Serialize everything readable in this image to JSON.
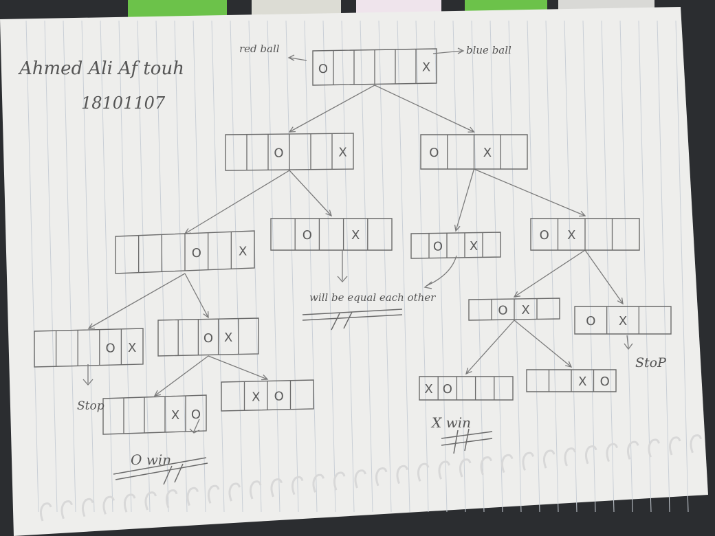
{
  "header": {
    "author": "Ahmed Ali Af touh",
    "id": "18101107"
  },
  "labels": {
    "red_ball": "red ball",
    "blue_ball": "blue ball",
    "equal": "will be equal each other",
    "stop_left": "Stop",
    "stop_right": "StoP",
    "o_win": "O win",
    "x_win": "X win"
  },
  "nodes": [
    {
      "id": "root",
      "cells": [
        "O",
        "",
        "",
        "",
        "",
        "X"
      ]
    },
    {
      "id": "n1",
      "cells": [
        "",
        "",
        "O",
        "",
        "",
        "X"
      ]
    },
    {
      "id": "n2",
      "cells": [
        "O",
        "",
        "X",
        ""
      ]
    },
    {
      "id": "n11",
      "cells": [
        "",
        "",
        "",
        "O",
        "",
        "X"
      ]
    },
    {
      "id": "n12",
      "cells": [
        "",
        "O",
        "",
        "X",
        ""
      ]
    },
    {
      "id": "n21",
      "cells": [
        "",
        "O",
        "",
        "X",
        ""
      ]
    },
    {
      "id": "n22",
      "cells": [
        "O",
        "X",
        "",
        ""
      ]
    },
    {
      "id": "n111",
      "cells": [
        "",
        "",
        "",
        "O",
        "X"
      ]
    },
    {
      "id": "n112",
      "cells": [
        "",
        "",
        "O",
        "X",
        ""
      ]
    },
    {
      "id": "n1121",
      "cells": [
        "",
        "",
        "",
        "X",
        "O"
      ]
    },
    {
      "id": "n1122",
      "cells": [
        "",
        "X",
        "O",
        ""
      ]
    },
    {
      "id": "n221",
      "cells": [
        "",
        "O",
        "X",
        ""
      ]
    },
    {
      "id": "n222",
      "cells": [
        "O",
        "X",
        ""
      ]
    },
    {
      "id": "n2211",
      "cells": [
        "X",
        "O",
        "",
        "",
        ""
      ]
    },
    {
      "id": "n2212",
      "cells": [
        "",
        "",
        "X",
        "O"
      ]
    }
  ],
  "colors": {
    "paper": "#eeeeec",
    "ink": "#6a6a6a",
    "rule": "#c9cfd6",
    "tab_green": "#6cc24a",
    "tab_white": "#dcdcd4",
    "tab_pink": "#efe4ec"
  }
}
